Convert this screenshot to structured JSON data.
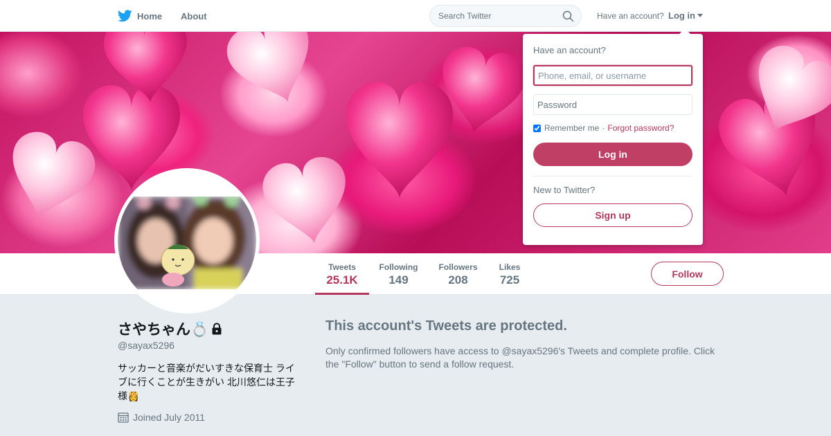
{
  "nav": {
    "home_label": "Home",
    "about_label": "About",
    "search_placeholder": "Search Twitter",
    "have_account": "Have an account?",
    "login_label": "Log in"
  },
  "dropdown": {
    "title": "Have an account?",
    "username_placeholder": "Phone, email, or username",
    "password_placeholder": "Password",
    "remember_label": "Remember me",
    "separator": "·",
    "forgot_label": "Forgot password?",
    "login_button": "Log in",
    "new_label": "New to Twitter?",
    "signup_button": "Sign up"
  },
  "stats": [
    {
      "label": "Tweets",
      "value": "25.1K"
    },
    {
      "label": "Following",
      "value": "149"
    },
    {
      "label": "Followers",
      "value": "208"
    },
    {
      "label": "Likes",
      "value": "725"
    }
  ],
  "follow_button": "Follow",
  "profile": {
    "name": "さやちゃん💍",
    "handle": "@sayax5296",
    "bio": "サッカーと音楽がだいすきな保育士 ライブに行くことが生きがい 北川悠仁は王子様👸",
    "joined": "Joined July 2011"
  },
  "protected": {
    "title": "This account's Tweets are protected.",
    "body": "Only confirmed followers have access to @sayax5296's Tweets and complete profile. Click the \"Follow\" button to send a follow request."
  },
  "colors": {
    "accent": "#b3365b",
    "twitter_blue": "#1da1f2",
    "muted": "#66757f",
    "background": "#e6ecf0"
  },
  "icons": [
    "twitter-bird-icon",
    "search-icon",
    "caret-down-icon",
    "lock-icon",
    "calendar-icon"
  ]
}
